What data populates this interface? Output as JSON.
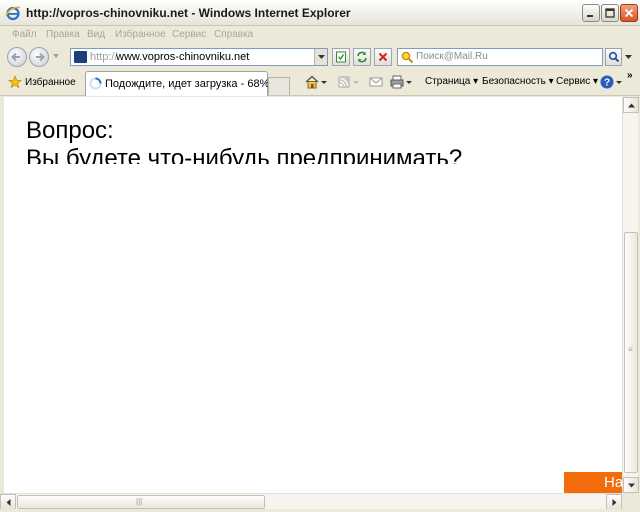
{
  "window": {
    "title": "http://vopros-chinovniku.net - Windows Internet Explorer"
  },
  "menu": [
    "Файл",
    "Правка",
    "Вид",
    "Избранное",
    "Сервис",
    "Справка"
  ],
  "address": {
    "protocol": "http://",
    "host": "www.vopros-chinovniku.net"
  },
  "search": {
    "placeholder": "Поиск@Mail.Ru"
  },
  "favorites_label": "Избранное",
  "tab": {
    "label": "Подождите, идет загрузка - 68%"
  },
  "commands": {
    "page": "Страница",
    "security": "Безопасность",
    "tools": "Сервис"
  },
  "content": {
    "heading": "Вопрос:",
    "question": "Вы будете что-нибудь предпринимать?",
    "button_label": "Нач"
  },
  "colors": {
    "accent_orange": "#f36c0c",
    "address_blue": "#1e3d7b"
  }
}
